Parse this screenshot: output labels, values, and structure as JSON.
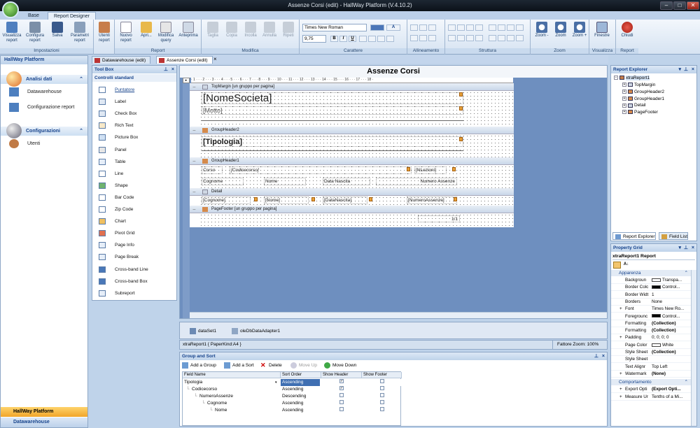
{
  "window": {
    "title": "Assenze Corsi (edit) - HallWay Platform (V.4.10.2)",
    "minimize": "–",
    "maximize": "□",
    "close": "✕"
  },
  "ribbon_tabs": [
    "Base",
    "Report Designer"
  ],
  "ribbon": {
    "groups": {
      "impostazioni": "Impostazioni",
      "report": "Report",
      "modifica": "Modifica",
      "carattere": "Carattere",
      "allineamento": "Allineamento",
      "struttura": "Struttura",
      "zoom": "Zoom",
      "visualizza": "Visualizza",
      "report2": "Report"
    },
    "buttons": {
      "visualizza_report": "Visualizza report",
      "configura_report": "Configura report",
      "salva": "Salva",
      "parametri_report": "Parametri report",
      "utenti_report": "Utenti report",
      "nuovo_report": "Nuovo report",
      "apri": "Apri...",
      "modifica_query": "Modifica query",
      "anteprima": "Anteprima",
      "taglia": "Taglia",
      "copia": "Copia",
      "incolla": "Incolla",
      "annulla": "Annulla",
      "ripeti": "Ripeti",
      "zoom_minus": "Zoom -",
      "zoom": "Zoom",
      "zoom_plus": "Zoom +",
      "finestre": "Finestre",
      "chiudi": "Chiudi"
    },
    "font_name": "Times New Roman",
    "font_size": "9,75",
    "bold": "B",
    "italic": "I",
    "underline": "U"
  },
  "doc_tabs": [
    "Datawarehouse (edit)",
    "Assenze Corsi (edit)"
  ],
  "doc_tab_close": "×",
  "nav": {
    "header": "HallWay Platform",
    "sections": [
      {
        "title": "Analisi dati",
        "items": [
          "Datawarehouse",
          "Configurazione report"
        ]
      },
      {
        "title": "Configurazioni",
        "items": [
          "Utenti"
        ]
      }
    ],
    "footer": [
      "HallWay Platform",
      "Datawarehouse"
    ]
  },
  "toolbox": {
    "title": "Tool Box",
    "section": "Controlli standard",
    "items": [
      "Puntatore",
      "Label",
      "Check Box",
      "Rich Text",
      "Picture Box",
      "Panel",
      "Table",
      "Line",
      "Shape",
      "Bar Code",
      "Zip Code",
      "Chart",
      "Pivot Grid",
      "Page Info",
      "Page Break",
      "Cross-band Line",
      "Cross-band Box",
      "Subreport"
    ]
  },
  "designer": {
    "report_title": "Assenze Corsi",
    "ruler": "· 1 · · · 2 · · · 3 · · · 4 · · · 5 · · · 6 · · · 7 · · · 8 · · · 9 · · · 10 · · · 11 · · · 12 · · · 13 · · · 14 · · · 15 · · · 16 · · · 17 · · · 18 ·",
    "bands": {
      "top_margin": "TopMargin [un gruppo per pagina]",
      "group_header2": "GroupHeader2",
      "group_header1": "GroupHeader1",
      "detail": "Detail",
      "page_footer": "PageFooter [un gruppo per pagina]"
    },
    "fields": {
      "nome_societa": "[NomeSocieta]",
      "motto": "[Motto]",
      "tipologia": "[Tipologia]",
      "corso": "Corso",
      "codicecorso": "[Codicecorso]",
      "nlezioni": "[NLezioni]",
      "h_cognome": "Cognome",
      "h_nome": "Nome",
      "h_datanascita": "Data Nascita",
      "h_numeroassenze": "Numero Assenze",
      "d_cognome": "[Cognome]",
      "d_nome": "[Nome]",
      "d_datanascita": "[DataNascita]",
      "d_numeroassenze": "[NumeroAssenze]",
      "page_info": "1/1"
    }
  },
  "tray": [
    "dataSet1",
    "oleDbDataAdapter1"
  ],
  "status": {
    "left": "xtraReport1 { PaperKind:A4 }",
    "right": "Fattore Zoom: 100%"
  },
  "group_sort": {
    "title": "Group and Sort",
    "buttons": [
      "Add a Group",
      "Add a Sort",
      "Delete",
      "Move Up",
      "Move Down"
    ],
    "columns": [
      "Field Name",
      "Sort Order",
      "Show Header",
      "Show Footer"
    ],
    "rows": [
      {
        "field": "Tipologia",
        "order": "Ascending",
        "header": true,
        "footer": false,
        "level": 0
      },
      {
        "field": "Codicecorso",
        "order": "Ascending",
        "header": true,
        "footer": false,
        "level": 1
      },
      {
        "field": "NumeroAssenze",
        "order": "Descending",
        "header": false,
        "footer": false,
        "level": 2
      },
      {
        "field": "Cognome",
        "order": "Ascending",
        "header": false,
        "footer": false,
        "level": 3
      },
      {
        "field": "Nome",
        "order": "Ascending",
        "header": false,
        "footer": false,
        "level": 4
      }
    ]
  },
  "report_explorer": {
    "title": "Report Explorer",
    "root": "xtraReport1",
    "nodes": [
      "TopMargin",
      "GroupHeader2",
      "GroupHeader1",
      "Detail",
      "PageFooter"
    ],
    "tabs": [
      "Report Explorer",
      "Field List"
    ]
  },
  "property_grid": {
    "title": "Property Grid",
    "selected": "xtraReport1   Report",
    "categories": [
      "Apparenza",
      "Comportamento"
    ],
    "rows": [
      {
        "name": "Backgroun",
        "value": "Transpa...",
        "color": "#ffffff"
      },
      {
        "name": "Border Colc",
        "value": "Control...",
        "color": "#000000"
      },
      {
        "name": "Border Widt",
        "value": "1"
      },
      {
        "name": "Borders",
        "value": "None"
      },
      {
        "name": "Font",
        "value": "Times New Ro..."
      },
      {
        "name": "Foregrounc",
        "value": "Control...",
        "color": "#000000"
      },
      {
        "name": "Formatting",
        "value": "(Collection)"
      },
      {
        "name": "Formatting",
        "value": "(Collection)"
      },
      {
        "name": "Padding",
        "value": "0; 0; 0; 0"
      },
      {
        "name": "Page Color",
        "value": "White",
        "color": "#ffffff"
      },
      {
        "name": "Style Sheet",
        "value": "(Collection)"
      },
      {
        "name": "Style Sheet",
        "value": ""
      },
      {
        "name": "Text Alignr",
        "value": "Top Left"
      },
      {
        "name": "Watermark",
        "value": "(None)"
      }
    ],
    "rows2": [
      {
        "name": "Export Opti",
        "value": "(Export Opti..."
      },
      {
        "name": "Measure Ur",
        "value": "Tenths of a Mi..."
      }
    ]
  },
  "colors": {
    "accent": "#15428b",
    "band": "#c9d7e9",
    "designer_bg": "#6e8fbf",
    "selection": "#3f6fb2"
  }
}
